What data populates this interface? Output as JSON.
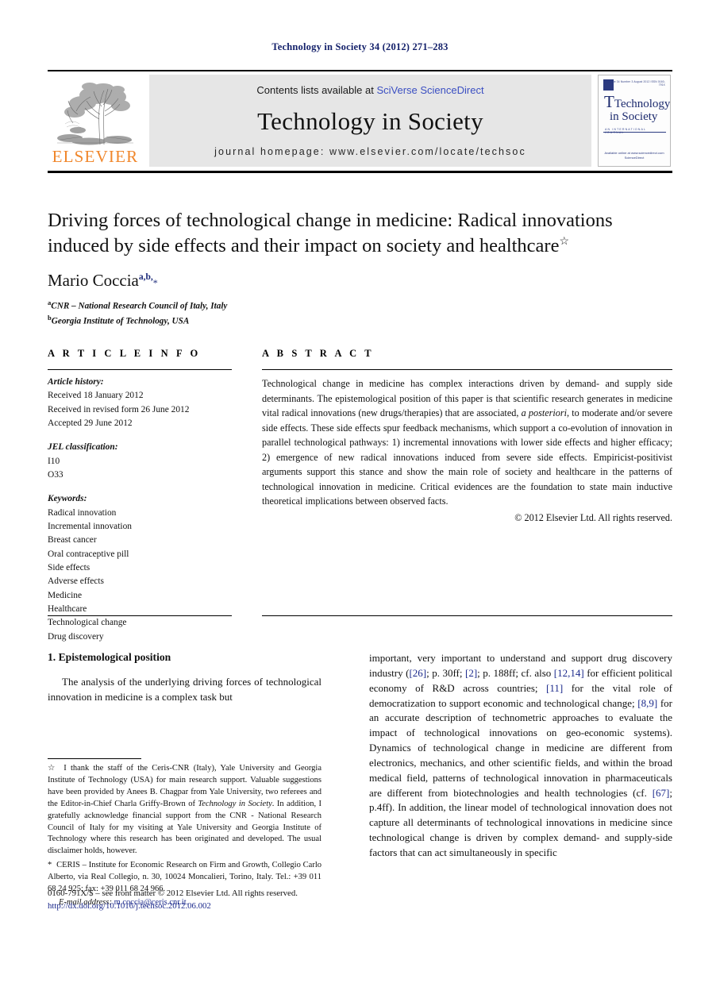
{
  "running_head": "Technology in Society 34 (2012) 271–283",
  "masthead": {
    "contents_prefix": "Contents lists available at ",
    "sciencedirect": "SciVerse ScienceDirect",
    "journal_name": "Technology in Society",
    "homepage": "journal homepage: www.elsevier.com/locate/techsoc",
    "publisher_wordmark": "ELSEVIER",
    "cover": {
      "line1": "Technology",
      "line2": "in Society",
      "subtitle": "AN INTERNATIONAL JOURNAL",
      "topline": "Volume 34  Number 3  August 2012  ISSN 0160-791X",
      "footer_line1": "Available online at www.sciencedirect.com",
      "footer_line2": "ScienceDirect"
    }
  },
  "article": {
    "title": "Driving forces of technological change in medicine: Radical innovations induced by side effects and their impact on society and healthcare",
    "title_marker": "☆",
    "author": "Mario Coccia",
    "author_sup": "a,b,",
    "author_corr": "*",
    "affiliations": [
      {
        "mark": "a",
        "text": "CNR – National Research Council of Italy, Italy"
      },
      {
        "mark": "b",
        "text": "Georgia Institute of Technology, USA"
      }
    ]
  },
  "info": {
    "heading": "A R T I C L E   I N F O",
    "history_label": "Article history:",
    "history": [
      "Received 18 January 2012",
      "Received in revised form 26 June 2012",
      "Accepted 29 June 2012"
    ],
    "jel_label": "JEL classification:",
    "jel": [
      "I10",
      "O33"
    ],
    "keywords_label": "Keywords:",
    "keywords": [
      "Radical innovation",
      "Incremental innovation",
      "Breast cancer",
      "Oral contraceptive pill",
      "Side effects",
      "Adverse effects",
      "Medicine",
      "Healthcare",
      "Technological change",
      "Drug discovery"
    ]
  },
  "abstract": {
    "heading": "A B S T R A C T",
    "text": "Technological change in medicine has complex interactions driven by demand- and supply side determinants. The epistemological position of this paper is that scientific research generates in medicine vital radical innovations (new drugs/therapies) that are associated, ",
    "italic_phrase": "a posteriori",
    "text_cont": ", to moderate and/or severe side effects. These side effects spur feedback mechanisms, which support a co-evolution of innovation in parallel technological pathways: 1) incremental innovations with lower side effects and higher efficacy; 2) emergence of new radical innovations induced from severe side effects. Empiricist-positivist arguments support this stance and show the main role of society and healthcare in the patterns of technological innovation in medicine. Critical evidences are the foundation to state main inductive theoretical implications between observed facts.",
    "copyright": "© 2012 Elsevier Ltd. All rights reserved."
  },
  "body": {
    "section_number_title": "1. Epistemological position",
    "left_paragraph": "The analysis of the underlying driving forces of technological innovation in medicine is a complex task but",
    "right_paragraph_parts": {
      "p1": "important, very important to understand and support drug discovery industry (",
      "c1": "[26]",
      "p2": "; p. 30ff; ",
      "c2": "[2]",
      "p3": "; p. 188ff; cf. also ",
      "c3": "[12,14]",
      "p4": " for efficient political economy of R&D across countries; ",
      "c4": "[11]",
      "p5": " for the vital role of democratization to support economic and technological change; ",
      "c5": "[8,9]",
      "p6": " for an accurate description of technometric approaches to evaluate the impact of technological innovations on geo-economic systems). Dynamics of technological change in medicine are different from electronics, mechanics, and other scientific fields, and within the broad medical field, patterns of technological innovation in pharmaceuticals are different from biotechnologies and health technologies (cf. ",
      "c6": "[67]",
      "p7": "; p.4ff). In addition, the linear model of technological innovation does not capture all determinants of technological innovations in medicine since technological change is driven by complex demand- and supply-side factors that can act simultaneously in specific"
    }
  },
  "footnotes": {
    "star_marker": "☆",
    "star_text_a": " I thank the staff of the Ceris-CNR (Italy), Yale University and Georgia Institute of Technology (USA) for main research support. Valuable suggestions have been provided by Anees B. Chagpar from Yale University, two referees and the Editor-in-Chief Charla Griffy-Brown of ",
    "star_italic": "Technology in Society",
    "star_text_b": ". In addition, I gratefully acknowledge financial support from the CNR - National Research Council of Italy for my visiting at Yale University and Georgia Institute of Technology where this research has been originated and developed. The usual disclaimer holds, however.",
    "corr_marker": "*",
    "corr_text": " CERIS – Institute for Economic Research on Firm and Growth, Collegio Carlo Alberto, via Real Collegio, n. 30, 10024 Moncalieri, Torino, Italy. Tel.: +39 011 68 24 925; fax: +39 011 68 24 966.",
    "email_label": "E-mail address:",
    "email": "m.coccia@ceris.cnr.it."
  },
  "imprint": {
    "front_matter": "0160-791X/$ – see front matter © 2012 Elsevier Ltd. All rights reserved.",
    "doi": "http://dx.doi.org/10.1016/j.techsoc.2012.06.002"
  },
  "colors": {
    "link_blue": "#1c2a8c",
    "header_navy": "#14216b",
    "elsevier_orange": "#f0862a",
    "band_gray": "#e6e6e6"
  }
}
